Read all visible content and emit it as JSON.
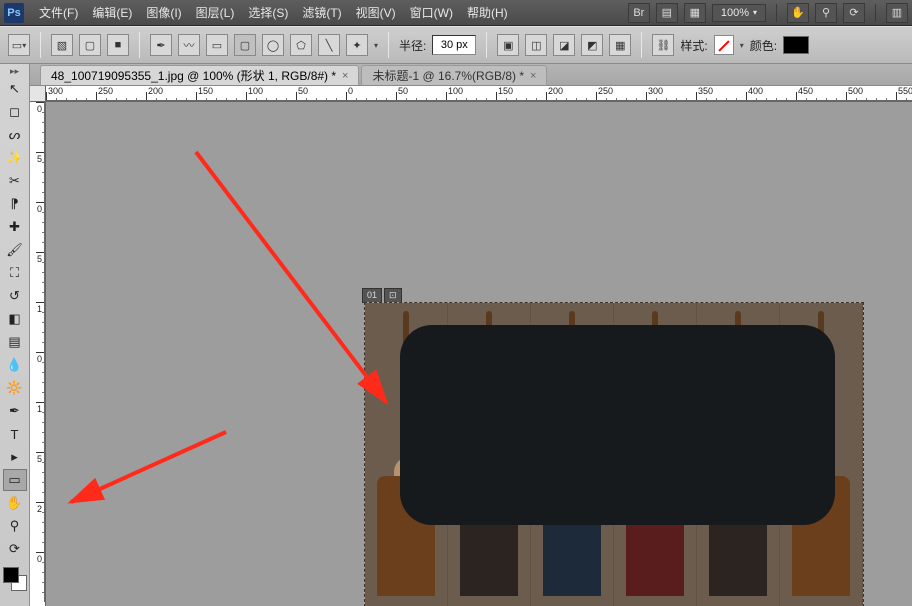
{
  "menu": {
    "items": [
      "文件(F)",
      "编辑(E)",
      "图像(I)",
      "图层(L)",
      "选择(S)",
      "滤镜(T)",
      "视图(V)",
      "窗口(W)",
      "帮助(H)"
    ],
    "zoom": "100%"
  },
  "options": {
    "radius_label": "半径:",
    "radius_value": "30 px",
    "style_label": "样式:",
    "color_label": "颜色:"
  },
  "tabs": [
    {
      "label": "48_100719095355_1.jpg @ 100% (形状 1, RGB/8#) *"
    },
    {
      "label": "未标题-1 @ 16.7%(RGB/8) *"
    }
  ],
  "artboard": {
    "badge1": "01",
    "badge2": "⊡"
  },
  "ruler_h": [
    "300",
    "250",
    "200",
    "150",
    "100",
    "50",
    "0",
    "50",
    "100",
    "150",
    "200",
    "250",
    "300",
    "350",
    "400",
    "450",
    "500",
    "550"
  ],
  "ruler_v": [
    "0",
    "5",
    "0",
    "5",
    "1",
    "0",
    "1",
    "5",
    "2",
    "0"
  ],
  "icons": {
    "br": "Br",
    "film": "▤",
    "grid": "▦",
    "hand": "✋",
    "mag": "⚲",
    "rot": "⟳",
    "panels": "▥"
  }
}
